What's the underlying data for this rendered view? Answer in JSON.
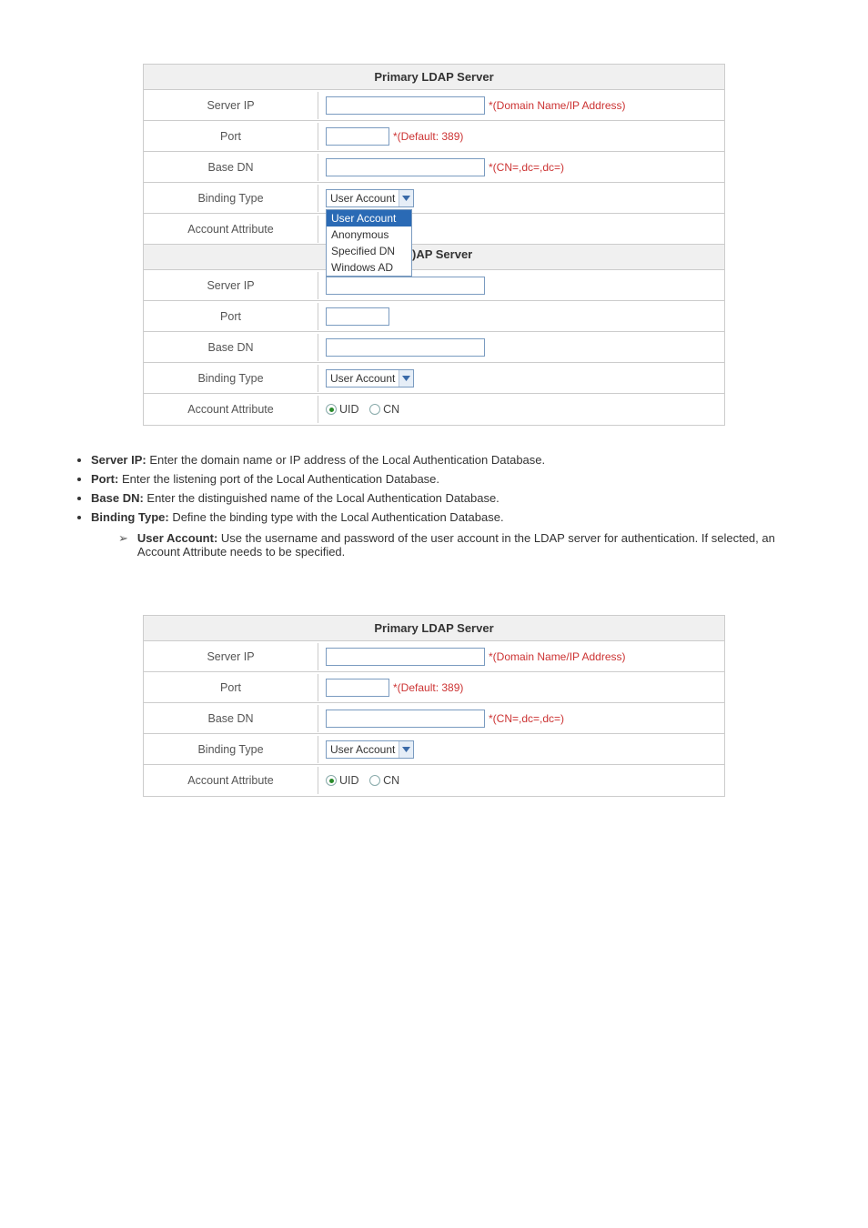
{
  "panel1": {
    "title": "Primary LDAP Server",
    "rows": {
      "server_ip_label": "Server IP",
      "server_ip_hint": "*(Domain Name/IP Address)",
      "port_label": "Port",
      "port_hint": "*(Default: 389)",
      "base_dn_label": "Base DN",
      "base_dn_hint": "*(CN=,dc=,dc=)",
      "binding_type_label": "Binding Type",
      "binding_type_value": "User Account",
      "dropdown_options": [
        "User Account",
        "Anonymous",
        "Specified DN",
        "Windows AD"
      ],
      "account_attr_label": "Account Attribute",
      "section2_title_frag": ")AP Server"
    }
  },
  "panel1_sec": {
    "server_ip_label": "Server IP",
    "port_label": "Port",
    "base_dn_label": "Base DN",
    "binding_type_label": "Binding Type",
    "binding_type_value": "User Account",
    "account_attr_label": "Account Attribute",
    "uid": "UID",
    "cn": "CN"
  },
  "bullets": {
    "b1": {
      "bold": "Server IP:",
      "text": " Enter the domain name or IP address of the Local Authentication Database."
    },
    "b2": {
      "bold": "Port:",
      "text": " Enter the listening port of the Local Authentication Database."
    },
    "b3": {
      "bold": "Base DN:",
      "text": " Enter the distinguished name of the Local Authentication Database."
    },
    "b4": {
      "bold": "Binding Type:",
      "text": " Define the binding type with the Local Authentication Database."
    },
    "arrow": {
      "bold": "User Account:",
      "text": " Use the username and password of the user account in the LDAP server for authentication. If selected, an Account Attribute needs to be specified."
    }
  },
  "panel2": {
    "title": "Primary LDAP Server",
    "server_ip_label": "Server IP",
    "server_ip_hint": "*(Domain Name/IP Address)",
    "port_label": "Port",
    "port_hint": "*(Default: 389)",
    "base_dn_label": "Base DN",
    "base_dn_hint": "*(CN=,dc=,dc=)",
    "binding_type_label": "Binding Type",
    "binding_type_value": "User Account",
    "account_attr_label": "Account Attribute",
    "uid": "UID",
    "cn": "CN"
  }
}
